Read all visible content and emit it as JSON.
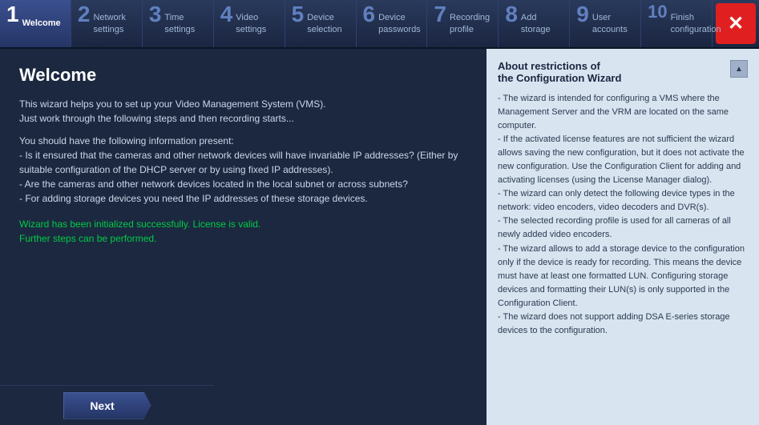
{
  "nav": {
    "items": [
      {
        "number": "1",
        "label": "Welcome",
        "active": true
      },
      {
        "number": "2",
        "label": "Network\nsettings",
        "active": false
      },
      {
        "number": "3",
        "label": "Time\nsettings",
        "active": false
      },
      {
        "number": "4",
        "label": "Video\nsettings",
        "active": false
      },
      {
        "number": "5",
        "label": "Device\nselection",
        "active": false
      },
      {
        "number": "6",
        "label": "Device\npasswords",
        "active": false
      },
      {
        "number": "7",
        "label": "Recording\nprofile",
        "active": false
      },
      {
        "number": "8",
        "label": "Add\nstorage",
        "active": false
      },
      {
        "number": "9",
        "label": "User\naccounts",
        "active": false
      },
      {
        "number": "10",
        "label": "Finish\nconfiguration",
        "active": false
      }
    ],
    "close_label": "✕"
  },
  "main": {
    "title": "Welcome",
    "paragraph1": "This wizard helps you to set up your Video Management System (VMS).\nJust work through the following steps and then recording starts...",
    "paragraph2": "You should have the following information present:\n - Is it ensured that the cameras and other network devices will have invariable IP addresses? (Either by suitable configuration of the DHCP server or by using fixed IP addresses).\n -  Are the cameras and other network devices located in the local subnet or across subnets?\n -  For adding storage devices you need the IP addresses of these storage devices.",
    "success_line1": "Wizard has been initialized successfully. License is valid.",
    "success_line2": "Further steps can be performed."
  },
  "right_panel": {
    "title_line1": "About restrictions of",
    "title_line2": "the Configuration Wizard",
    "content": "- The wizard is intended for configuring a VMS where the Management Server and the VRM are located on the same computer.\n- If the activated license features are not sufficient the wizard allows saving the new configuration, but it does not activate the new configuration. Use the Configuration Client for adding and activating licenses  (using the License Manager dialog).\n- The wizard can only detect the following device types in the network: video encoders, video decoders and DVR(s).\n- The selected recording profile is used for all cameras of all newly added video encoders.\n- The wizard allows to add a storage device to the configuration only if the device is ready for recording. This means the device must have at least one formatted LUN. Configuring storage devices and formatting their LUN(s) is only supported in the Configuration Client.\n- The wizard does not support adding DSA E-series storage devices to the configuration."
  },
  "footer": {
    "next_label": "Next"
  }
}
